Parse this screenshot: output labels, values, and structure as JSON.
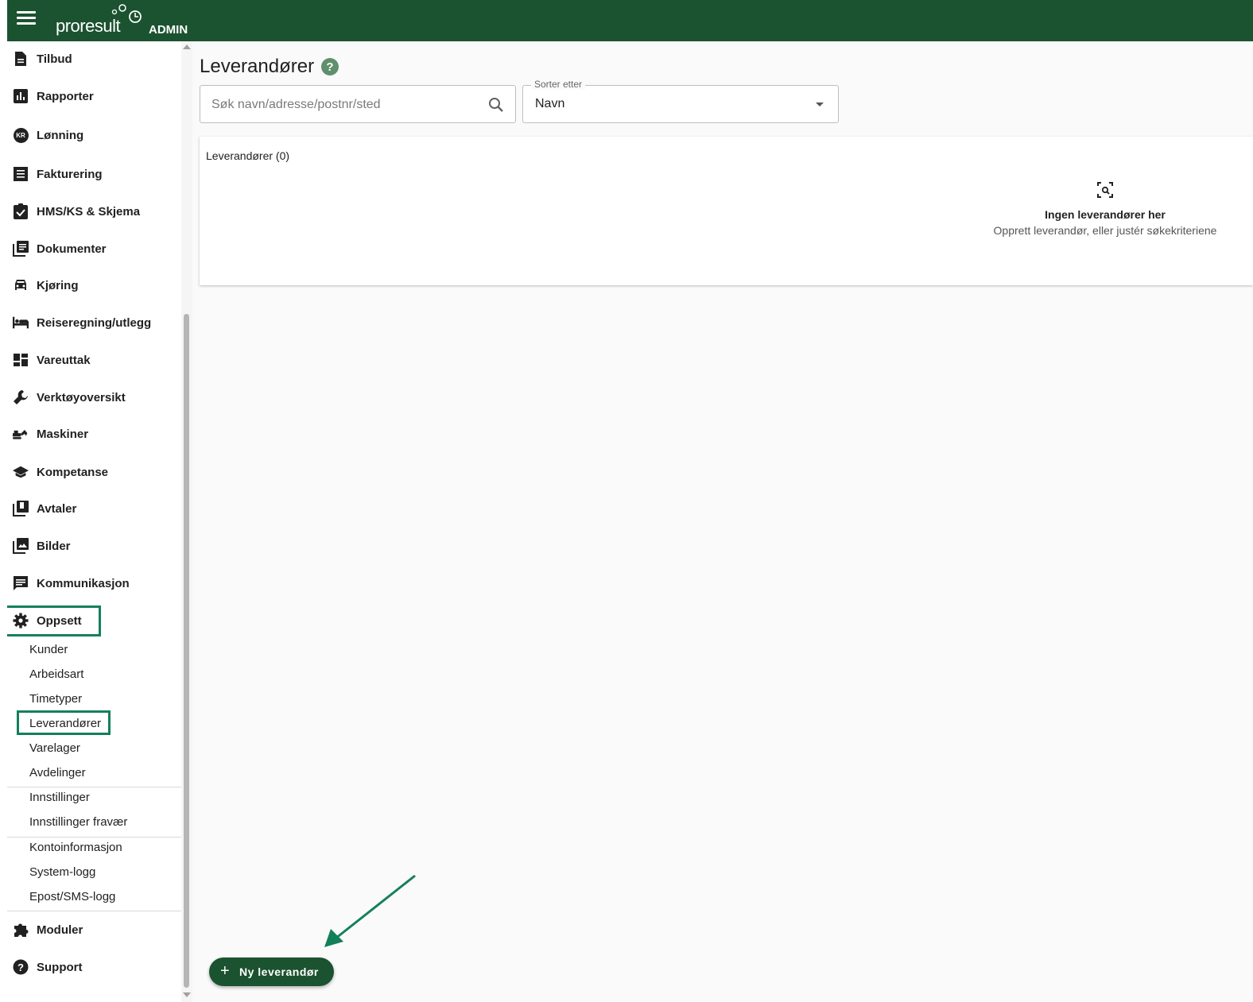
{
  "topbar": {
    "logo_text": "proresult",
    "admin_label": "ADMIN"
  },
  "sidebar": {
    "items": [
      {
        "label": "Tilbud",
        "icon": "document-icon"
      },
      {
        "label": "Rapporter",
        "icon": "bar-chart-icon"
      },
      {
        "label": "Lønning",
        "icon": "kr-icon",
        "icon_text": "KR"
      },
      {
        "label": "Fakturering",
        "icon": "receipt-icon"
      },
      {
        "label": "HMS/KS & Skjema",
        "icon": "clipboard-check-icon"
      },
      {
        "label": "Dokumenter",
        "icon": "library-books-icon"
      },
      {
        "label": "Kjøring",
        "icon": "car-icon"
      },
      {
        "label": "Reiseregning/utlegg",
        "icon": "hotel-bed-icon"
      },
      {
        "label": "Vareuttak",
        "icon": "dashboard-icon"
      },
      {
        "label": "Verktøyoversikt",
        "icon": "wrench-icon"
      },
      {
        "label": "Maskiner",
        "icon": "excavator-icon"
      },
      {
        "label": "Kompetanse",
        "icon": "school-icon"
      },
      {
        "label": "Avtaler",
        "icon": "library-add-icon"
      },
      {
        "label": "Bilder",
        "icon": "photo-library-icon"
      },
      {
        "label": "Kommunikasjon",
        "icon": "chat-icon"
      },
      {
        "label": "Oppsett",
        "icon": "gear-icon"
      }
    ],
    "oppsett_sub": {
      "group1": [
        "Kunder",
        "Arbeidsart",
        "Timetyper",
        "Leverandører",
        "Varelager",
        "Avdelinger"
      ],
      "group2": [
        "Innstillinger",
        "Innstillinger fravær"
      ],
      "group3": [
        "Kontoinformasjon",
        "System-logg",
        "Epost/SMS-logg"
      ]
    },
    "bottom_items": [
      {
        "label": "Moduler",
        "icon": "puzzle-icon"
      },
      {
        "label": "Support",
        "icon": "help-circle-icon"
      }
    ]
  },
  "main": {
    "title": "Leverandører",
    "search": {
      "placeholder": "Søk navn/adresse/postnr/sted",
      "value": ""
    },
    "sort": {
      "legend": "Sorter etter",
      "value": "Navn"
    },
    "card": {
      "title": "Leverandører (0)",
      "empty_title": "Ingen leverandører her",
      "empty_subtitle": "Opprett leverandør, eller justér søkekriteriene"
    },
    "fab": {
      "icon": "+",
      "label": "Ny leverandør"
    }
  },
  "colors": {
    "brand_green": "#1b5230",
    "annotation_green": "#14805a"
  }
}
